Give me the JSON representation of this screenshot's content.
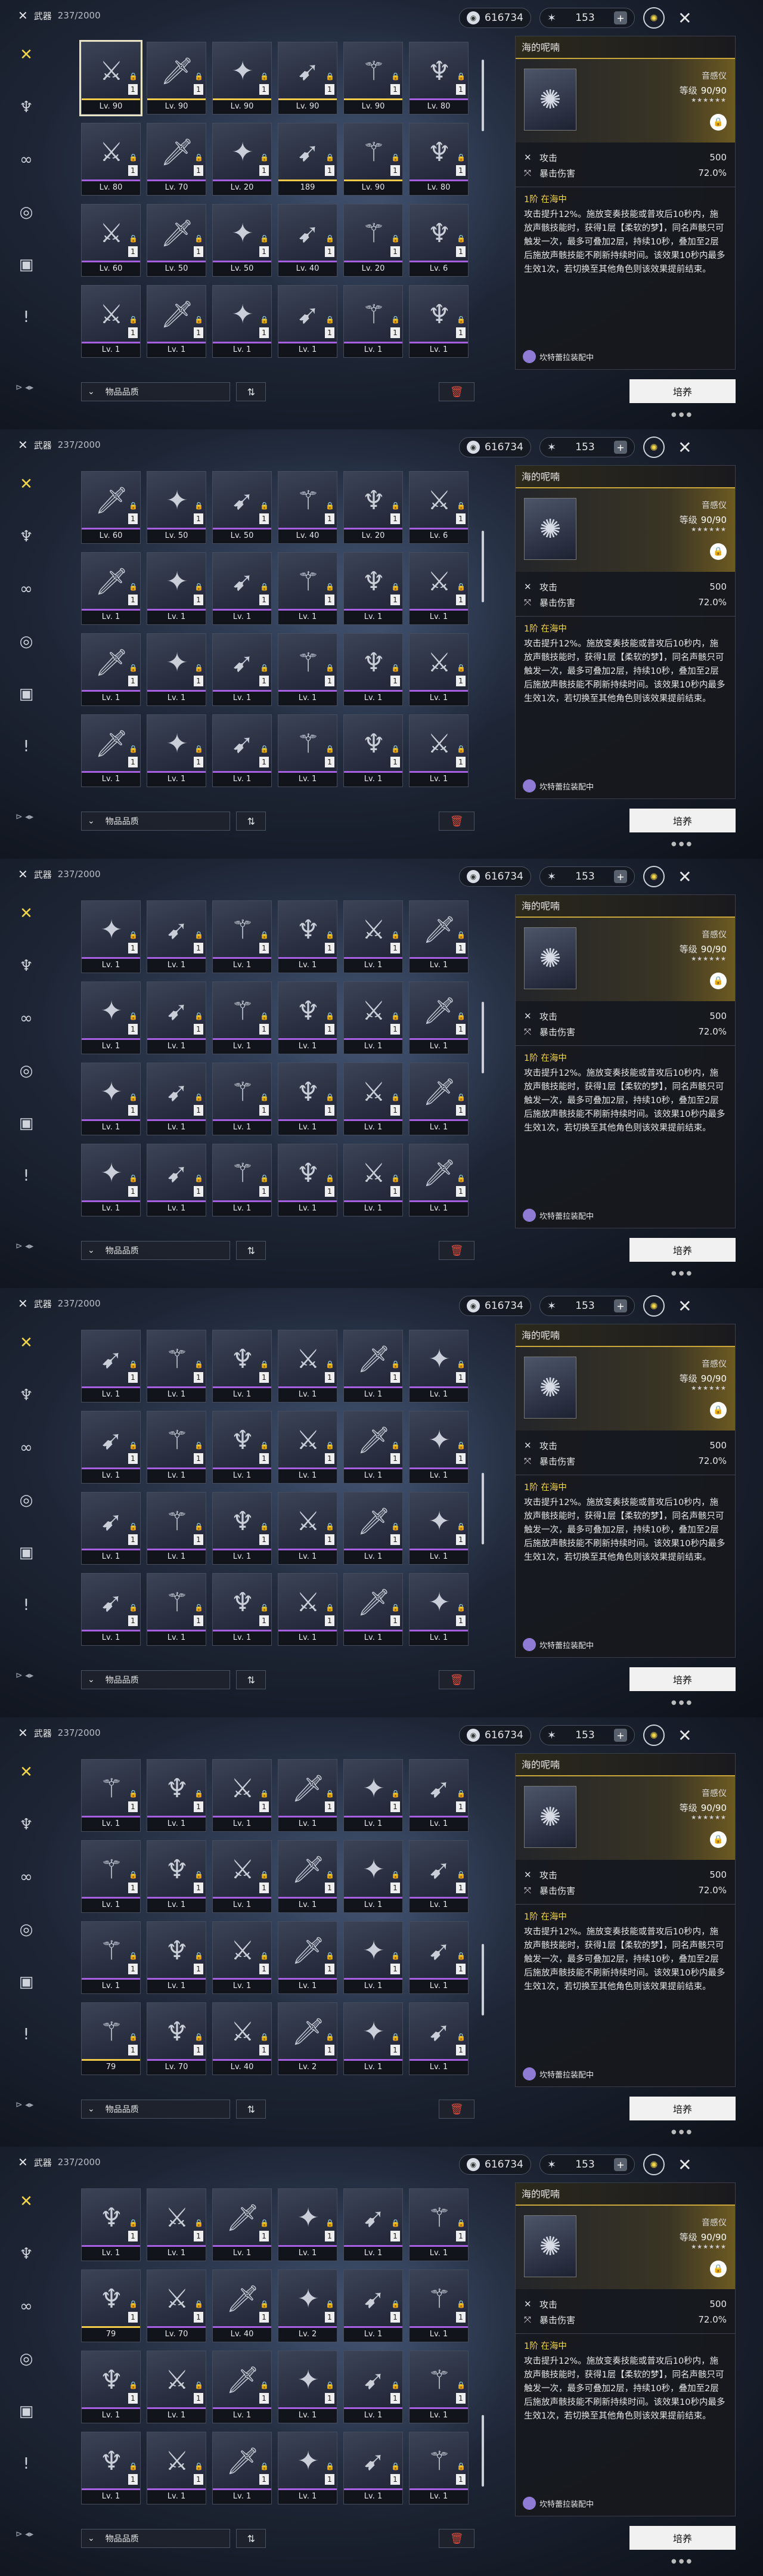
{
  "header": {
    "section": "武器",
    "count": "237/2000"
  },
  "currency": {
    "coins": "616734",
    "stars": "153"
  },
  "sidebar": {
    "bottom_label": "⊳ ◂▸"
  },
  "sorter": {
    "label": "物品品质"
  },
  "detail": {
    "name": "海的呢喃",
    "type": "音感仪",
    "level_label": "等级",
    "level": "90/90",
    "rank": "★★★★★★",
    "stats": [
      {
        "name": "攻击",
        "value": "500"
      },
      {
        "name": "暴击伤害",
        "value": "72.0%"
      }
    ],
    "passive_title": "1阶 在海中",
    "passive_text": "攻击提升12%。施放变奏技能或普攻后10秒内，施放声骸技能时，获得1层【柔软的梦】，同名声骸只可触发一次，最多可叠加2层，持续10秒，叠加至2层后施放声骸技能不刷新持续时间。该效果10秒内最多生效1次，若切换至其他角色则该效果提前结束。",
    "equipped_by": "坎特蕾拉装配中"
  },
  "upgrade_label": "培养",
  "icons": {
    "close": "close-icon",
    "settings": "gear-icon",
    "trash": "trash-icon"
  },
  "panels": [
    {
      "rows": [
        [
          "Lv. 90",
          "Lv. 90",
          "Lv. 90",
          "Lv. 90",
          "Lv. 90",
          "Lv. 80"
        ],
        [
          "Lv. 80",
          "Lv. 70",
          "Lv. 20",
          "189",
          "Lv. 90",
          "Lv. 80"
        ],
        [
          "Lv. 60",
          "Lv. 50",
          "Lv. 50",
          "Lv. 40",
          "Lv. 20",
          "Lv. 6"
        ],
        [
          "Lv. 1",
          "Lv. 1",
          "Lv. 1",
          "Lv. 1",
          "Lv. 1",
          "Lv. 1"
        ]
      ]
    },
    {
      "rows": [
        [
          "Lv. 60",
          "Lv. 50",
          "Lv. 50",
          "Lv. 40",
          "Lv. 20",
          "Lv. 6"
        ],
        [
          "Lv. 1",
          "Lv. 1",
          "Lv. 1",
          "Lv. 1",
          "Lv. 1",
          "Lv. 1"
        ],
        [
          "Lv. 1",
          "Lv. 1",
          "Lv. 1",
          "Lv. 1",
          "Lv. 1",
          "Lv. 1"
        ],
        [
          "Lv. 1",
          "Lv. 1",
          "Lv. 1",
          "Lv. 1",
          "Lv. 1",
          "Lv. 1"
        ]
      ]
    },
    {
      "rows": [
        [
          "Lv. 1",
          "Lv. 1",
          "Lv. 1",
          "Lv. 1",
          "Lv. 1",
          "Lv. 1"
        ],
        [
          "Lv. 1",
          "Lv. 1",
          "Lv. 1",
          "Lv. 1",
          "Lv. 1",
          "Lv. 1"
        ],
        [
          "Lv. 1",
          "Lv. 1",
          "Lv. 1",
          "Lv. 1",
          "Lv. 1",
          "Lv. 1"
        ],
        [
          "Lv. 1",
          "Lv. 1",
          "Lv. 1",
          "Lv. 1",
          "Lv. 1",
          "Lv. 1"
        ]
      ]
    },
    {
      "rows": [
        [
          "Lv. 1",
          "Lv. 1",
          "Lv. 1",
          "Lv. 1",
          "Lv. 1",
          "Lv. 1"
        ],
        [
          "Lv. 1",
          "Lv. 1",
          "Lv. 1",
          "Lv. 1",
          "Lv. 1",
          "Lv. 1"
        ],
        [
          "Lv. 1",
          "Lv. 1",
          "Lv. 1",
          "Lv. 1",
          "Lv. 1",
          "Lv. 1"
        ],
        [
          "Lv. 1",
          "Lv. 1",
          "Lv. 1",
          "Lv. 1",
          "Lv. 1",
          "Lv. 1"
        ]
      ]
    },
    {
      "rows": [
        [
          "Lv. 1",
          "Lv. 1",
          "Lv. 1",
          "Lv. 1",
          "Lv. 1",
          "Lv. 1"
        ],
        [
          "Lv. 1",
          "Lv. 1",
          "Lv. 1",
          "Lv. 1",
          "Lv. 1",
          "Lv. 1"
        ],
        [
          "Lv. 1",
          "Lv. 1",
          "Lv. 1",
          "Lv. 1",
          "Lv. 1",
          "Lv. 1"
        ],
        [
          "79",
          "Lv. 70",
          "Lv. 40",
          "Lv. 2",
          "Lv. 1",
          "Lv. 1"
        ]
      ]
    },
    {
      "rows": [
        [
          "Lv. 1",
          "Lv. 1",
          "Lv. 1",
          "Lv. 1",
          "Lv. 1",
          "Lv. 1"
        ],
        [
          "79",
          "Lv. 70",
          "Lv. 40",
          "Lv. 2",
          "Lv. 1",
          "Lv. 1"
        ],
        [
          "Lv. 1",
          "Lv. 1",
          "Lv. 1",
          "Lv. 1",
          "Lv. 1",
          "Lv. 1"
        ],
        [
          "Lv. 1",
          "Lv. 1",
          "Lv. 1",
          "Lv. 1",
          "Lv. 1",
          "Lv. 1"
        ]
      ]
    }
  ]
}
